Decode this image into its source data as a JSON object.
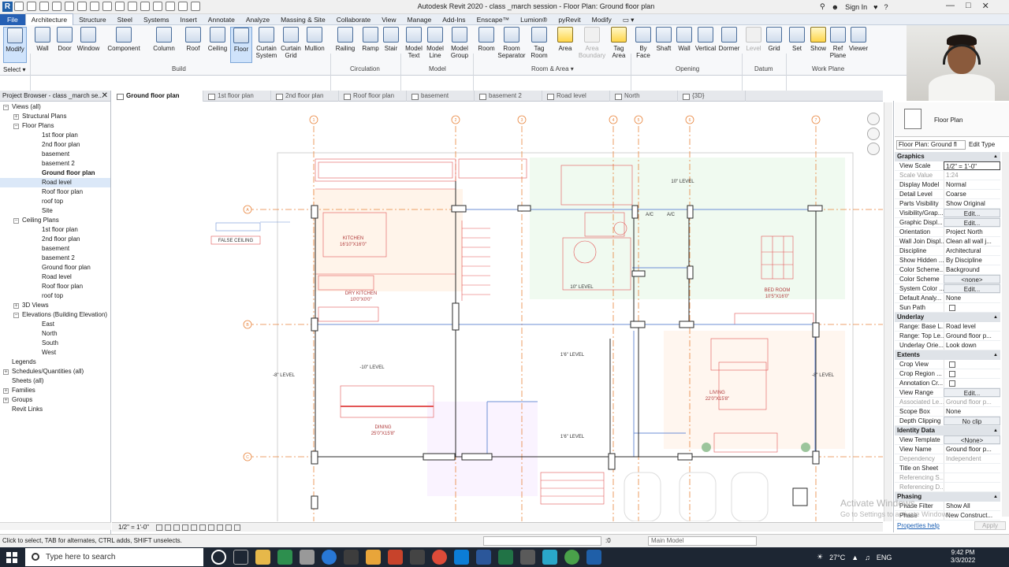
{
  "window": {
    "title": "Autodesk Revit 2020 - class _march session - Floor Plan: Ground floor plan",
    "sign_in": "Sign In",
    "help": "?"
  },
  "menu_tabs": [
    "File",
    "Architecture",
    "Structure",
    "Steel",
    "Systems",
    "Insert",
    "Annotate",
    "Analyze",
    "Massing & Site",
    "Collaborate",
    "View",
    "Manage",
    "Add-Ins",
    "Enscape™",
    "Lumion®",
    "pyRevit",
    "Modify",
    "▭ ▾"
  ],
  "ribbon": {
    "buttons": [
      "Modify",
      "Wall",
      "Door",
      "Window",
      "Component",
      "Column",
      "Roof",
      "Ceiling",
      "Floor",
      "Curtain System",
      "Curtain Grid",
      "Mullion",
      "Railing",
      "Ramp",
      "Stair",
      "Model Text",
      "Model Line",
      "Model Group",
      "Room",
      "Room Separator",
      "Tag Room",
      "Area",
      "Area Boundary",
      "Tag Area",
      "By Face",
      "Shaft",
      "Wall",
      "Vertical",
      "Dormer",
      "Level",
      "Grid",
      "Set",
      "Show",
      "Ref Plane",
      "Viewer"
    ],
    "panels": [
      "Select ▾",
      "Build",
      "Circulation",
      "Model",
      "Room & Area ▾",
      "Opening",
      "Datum",
      "Work Plane"
    ]
  },
  "view_tabs": [
    "Ground floor plan",
    "1st floor plan",
    "2nd floor plan",
    "Roof floor plan",
    "basement",
    "basement 2",
    "Road level",
    "North",
    "{3D}"
  ],
  "project_browser": {
    "title": "Project Browser - class _march se...",
    "close": "✕",
    "tree": [
      {
        "label": "Views (all)",
        "tw": "−"
      },
      {
        "label": "Structural Plans",
        "tw": "+"
      },
      {
        "label": "Floor Plans",
        "tw": "−"
      },
      {
        "label": "1st floor plan"
      },
      {
        "label": "2nd floor plan"
      },
      {
        "label": "basement"
      },
      {
        "label": "basement 2"
      },
      {
        "label": "Ground floor plan"
      },
      {
        "label": "Road level"
      },
      {
        "label": "Roof floor plan"
      },
      {
        "label": "roof top"
      },
      {
        "label": "Site"
      },
      {
        "label": "Ceiling Plans",
        "tw": "−"
      },
      {
        "label": "1st floor plan"
      },
      {
        "label": "2nd floor plan"
      },
      {
        "label": "basement"
      },
      {
        "label": "basement 2"
      },
      {
        "label": "Ground floor plan"
      },
      {
        "label": "Road level"
      },
      {
        "label": "Roof floor plan"
      },
      {
        "label": "roof top"
      },
      {
        "label": "3D Views",
        "tw": "+"
      },
      {
        "label": "Elevations (Building Elevation)",
        "tw": "−"
      },
      {
        "label": "East"
      },
      {
        "label": "North"
      },
      {
        "label": "South"
      },
      {
        "label": "West"
      },
      {
        "label": "Legends"
      },
      {
        "label": "Schedules/Quantities (all)",
        "tw": "+"
      },
      {
        "label": "Sheets (all)"
      },
      {
        "label": "Families",
        "tw": "+"
      },
      {
        "label": "Groups",
        "tw": "+"
      },
      {
        "label": "Revit Links"
      }
    ]
  },
  "plan": {
    "grid_bubbles": [
      "1",
      "2",
      "3",
      "4",
      "5",
      "6",
      "7",
      "A",
      "B",
      "C"
    ],
    "rooms": [
      {
        "name": "KITCHEN",
        "dim": "16'10\"X16'0\""
      },
      {
        "name": "DRY KITCHEN",
        "dim": "10'0\"X0'0\""
      },
      {
        "name": "BED ROOM",
        "dim": "10'5\"X16'0\""
      },
      {
        "name": "LIVING",
        "dim": "22'0\"X15'8\""
      },
      {
        "name": "DINING",
        "dim": "25'0\"X15'8\""
      }
    ],
    "levels": [
      "10\" LEVEL",
      "10\" LEVEL",
      "-10\" LEVEL",
      "1'6\" LEVEL",
      "1'6\" LEVEL",
      "-8\" LEVEL",
      "-8\" LEVEL"
    ],
    "ac": [
      "A/C",
      "A/C"
    ],
    "ceiling_tag": "FALSE CEILING"
  },
  "view_control": {
    "scale": "1/2\" = 1'-0\""
  },
  "properties": {
    "type": "Floor Plan",
    "instance": "Floor Plan: Ground fl",
    "edit_type": "Edit Type",
    "groups": [
      {
        "name": "Graphics",
        "rows": [
          {
            "k": "View Scale",
            "v": "1/2\" = 1'-0\"",
            "t": "field"
          },
          {
            "k": "Scale Value",
            "v": "1:24",
            "t": "dim"
          },
          {
            "k": "Display Model",
            "v": "Normal"
          },
          {
            "k": "Detail Level",
            "v": "Coarse"
          },
          {
            "k": "Parts Visibility",
            "v": "Show Original"
          },
          {
            "k": "Visibility/Grap...",
            "v": "Edit...",
            "t": "btn"
          },
          {
            "k": "Graphic Displ...",
            "v": "Edit...",
            "t": "btn"
          },
          {
            "k": "Orientation",
            "v": "Project North"
          },
          {
            "k": "Wall Join Displ...",
            "v": "Clean all wall j..."
          },
          {
            "k": "Discipline",
            "v": "Architectural"
          },
          {
            "k": "Show Hidden ...",
            "v": "By Discipline"
          },
          {
            "k": "Color Scheme...",
            "v": "Background"
          },
          {
            "k": "Color Scheme",
            "v": "<none>",
            "t": "btn"
          },
          {
            "k": "System Color ...",
            "v": "Edit...",
            "t": "btn"
          },
          {
            "k": "Default Analy...",
            "v": "None"
          },
          {
            "k": "Sun Path",
            "v": "",
            "t": "cb"
          }
        ]
      },
      {
        "name": "Underlay",
        "rows": [
          {
            "k": "Range: Base L...",
            "v": "Road level"
          },
          {
            "k": "Range: Top Le...",
            "v": "Ground floor p..."
          },
          {
            "k": "Underlay Orie...",
            "v": "Look down"
          }
        ]
      },
      {
        "name": "Extents",
        "rows": [
          {
            "k": "Crop View",
            "v": "",
            "t": "cb"
          },
          {
            "k": "Crop Region ...",
            "v": "",
            "t": "cb"
          },
          {
            "k": "Annotation Cr...",
            "v": "",
            "t": "cb"
          },
          {
            "k": "View Range",
            "v": "Edit...",
            "t": "btn"
          },
          {
            "k": "Associated Le...",
            "v": "Ground floor p...",
            "t": "dim"
          },
          {
            "k": "Scope Box",
            "v": "None"
          },
          {
            "k": "Depth Clipping",
            "v": "No clip",
            "t": "btn"
          }
        ]
      },
      {
        "name": "Identity Data",
        "rows": [
          {
            "k": "View Template",
            "v": "<None>",
            "t": "btn"
          },
          {
            "k": "View Name",
            "v": "Ground floor p..."
          },
          {
            "k": "Dependency",
            "v": "Independent",
            "t": "dim"
          },
          {
            "k": "Title on Sheet",
            "v": ""
          },
          {
            "k": "Referencing S...",
            "v": "",
            "t": "dim"
          },
          {
            "k": "Referencing D...",
            "v": "",
            "t": "dim"
          }
        ]
      },
      {
        "name": "Phasing",
        "rows": [
          {
            "k": "Phase Filter",
            "v": "Show All"
          },
          {
            "k": "Phase",
            "v": "New Construct..."
          }
        ]
      }
    ],
    "help_link": "Properties help",
    "apply": "Apply"
  },
  "watermark": {
    "line1": "Activate Windows",
    "line2": "Go to Settings to activate Windows."
  },
  "status": {
    "text": "Click to select, TAB for alternates, CTRL adds, SHIFT unselects.",
    "zero": ":0",
    "model": "Main Model"
  },
  "taskbar": {
    "search": "Type here to search",
    "temp": "27°C",
    "lang": "ENG",
    "time": "9:42 PM",
    "date": "3/3/2022"
  },
  "colors": {
    "file_tab": "#2660b4",
    "grid": "#e8843c",
    "walls": "#2a2a2a",
    "red_lines": "#e35555",
    "blue_lines": "#6d8fd6"
  }
}
